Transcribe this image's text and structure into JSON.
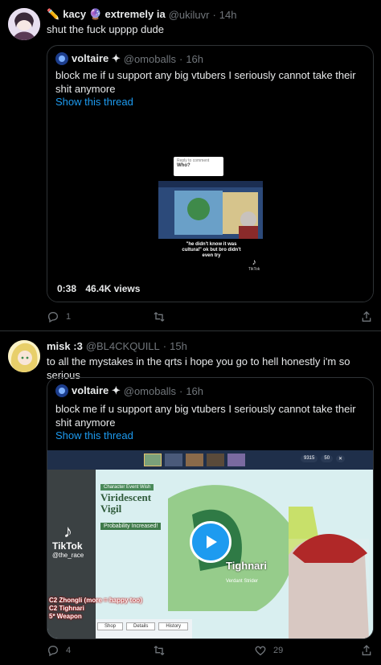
{
  "tweets": [
    {
      "display_name": "kacy 🔮 extremely ia",
      "handle": "@ukiluvr",
      "time": "14h",
      "text": "shut the fuck upppp dude",
      "quote": {
        "display_name": "voltaire ✦",
        "handle": "@omoballs",
        "time": "16h",
        "text": "block me if u support any big vtubers I seriously cannot take their shit anymore",
        "show_thread": "Show this thread",
        "video_duration": "0:38",
        "video_views": "46.4K views",
        "video_comment_title": "Who?",
        "video_comment_header": "Reply to comment",
        "video_caption": "\"he didn't know it was cultural\" ok but bro didn't even try",
        "tiktok_label": "TikTok"
      },
      "reply_count": "1",
      "retweet_count": ""
    },
    {
      "display_name": "misk :3",
      "handle": "@BL4CKQUILL",
      "time": "15h",
      "text": "to all the mystakes in the qrts i hope you go to hell honestly i'm so serious",
      "quote": {
        "display_name": "voltaire ✦",
        "handle": "@omoballs",
        "time": "16h",
        "text": "block me if u support any big vtubers I seriously cannot take their shit anymore",
        "show_thread": "Show this thread",
        "banner_tag": "Character Event Wish",
        "banner_title": "Viridescent Vigil",
        "banner_prob": "Probability Increased!",
        "character_name": "Tighnari",
        "character_sub": "Verdant Strider",
        "currency_1": "9315",
        "currency_2": "50",
        "overlay_lines": [
          "C2 Zhongli (more = happy too)",
          "C2 Tighnari",
          "5* Weapon"
        ],
        "tiktok_label": "TikTok",
        "tiktok_handle": "@the_race",
        "btn_shop": "Shop",
        "btn_details": "Details",
        "btn_history": "History"
      },
      "reply_count": "4",
      "retweet_count": "",
      "like_count": "29"
    }
  ],
  "colors": {
    "accent": "#1d9bf0",
    "muted": "#71767b",
    "border": "#2f3336",
    "play": "#1d9bf0"
  }
}
